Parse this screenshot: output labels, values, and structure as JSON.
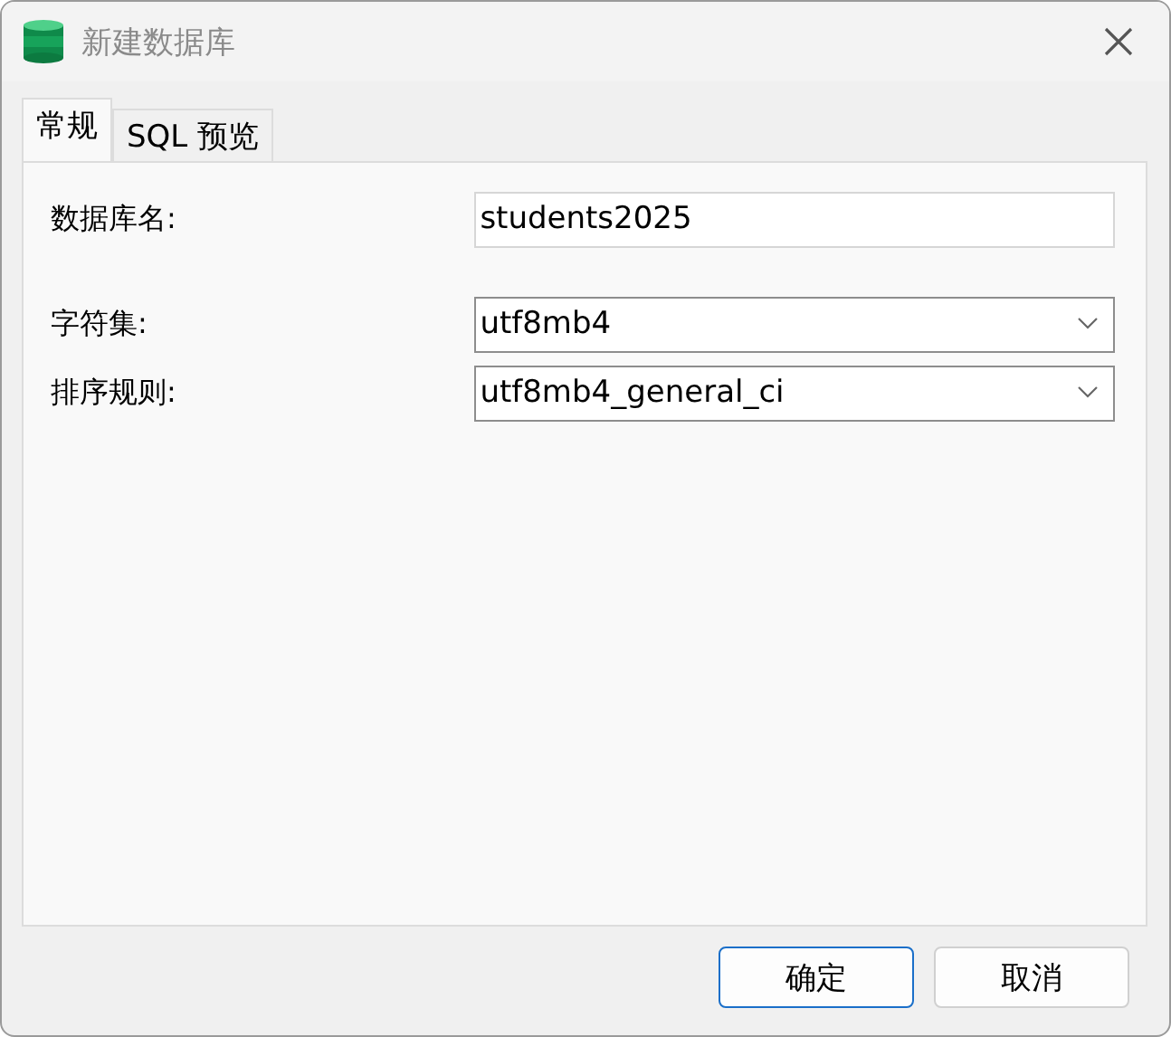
{
  "window": {
    "title": "新建数据库"
  },
  "tabs": [
    {
      "label": "常规",
      "selected": true
    },
    {
      "label": "SQL 预览",
      "selected": false
    }
  ],
  "fields": [
    {
      "label": "数据库名:",
      "kind": "text",
      "value": "students2025"
    },
    {
      "label": "字符集:",
      "kind": "select",
      "value": "utf8mb4"
    },
    {
      "label": "排序规则:",
      "kind": "select",
      "value": "utf8mb4_general_ci"
    }
  ],
  "buttons": [
    {
      "label": "确定",
      "default": true
    },
    {
      "label": "取消",
      "default": false
    }
  ]
}
